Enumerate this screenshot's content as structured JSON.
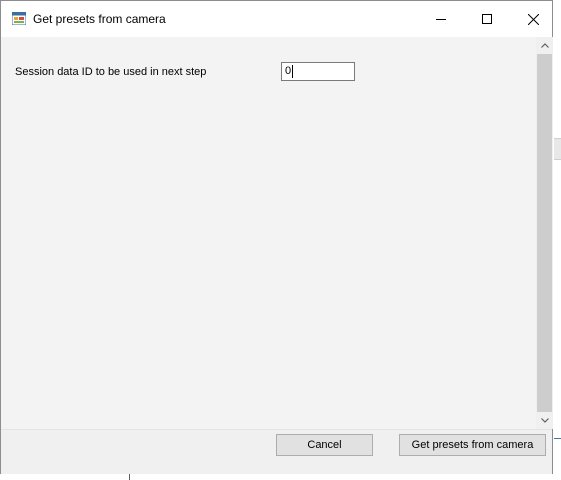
{
  "window": {
    "title": "Get presets from camera",
    "icons": {
      "app": "app-window-icon",
      "minimize": "minimize-icon",
      "maximize": "maximize-icon",
      "close": "close-icon"
    }
  },
  "form": {
    "session_label": "Session data ID to be used in next step",
    "session_value": "0"
  },
  "scrollbar": {
    "up_icon": "chevron-up-icon",
    "down_icon": "chevron-down-icon"
  },
  "buttons": {
    "cancel_label": "Cancel",
    "get_presets_label": "Get presets from camera"
  }
}
